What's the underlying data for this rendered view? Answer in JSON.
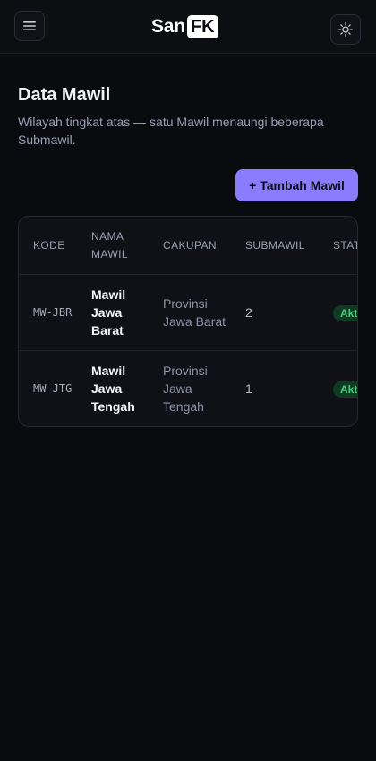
{
  "header": {
    "logo_main": "San",
    "logo_box": "FK",
    "menu_icon": "menu-icon",
    "theme_icon": "sun-icon"
  },
  "page": {
    "title": "Data Mawil",
    "description": "Wilayah tingkat atas — satu Mawil menaungi beberapa Submawil.",
    "add_button": "+ Tambah Mawil"
  },
  "table": {
    "headers": {
      "kode": "KODE",
      "nama": "NAMA MAWIL",
      "cakupan": "CAKUPAN",
      "submawil": "SUBMAWIL",
      "status": "STATUS"
    },
    "rows": [
      {
        "kode": "MW-JBR",
        "nama": "Mawil Jawa Barat",
        "cakupan": "Provinsi Jawa Barat",
        "submawil": "2",
        "status": "Aktif"
      },
      {
        "kode": "MW-JTG",
        "nama": "Mawil Jawa Tengah",
        "cakupan": "Provinsi Jawa Tengah",
        "submawil": "1",
        "status": "Aktif"
      }
    ]
  },
  "colors": {
    "accent": "#8b7cff",
    "badge_bg": "#103a22",
    "badge_text": "#3fd07a",
    "background": "#0a0b0e"
  }
}
